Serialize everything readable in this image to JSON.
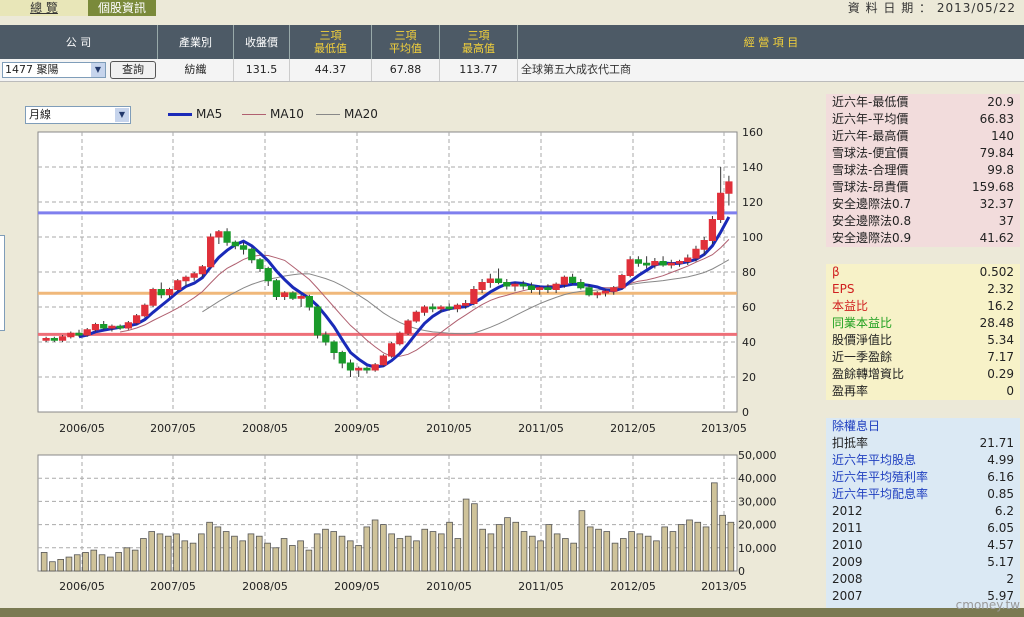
{
  "tabs": {
    "overview": "總 覽",
    "stock_info": "個股資訊"
  },
  "date_label": "資 料 日 期 ： 2013/05/22",
  "header": {
    "company": "公 司",
    "industry": "產業別",
    "close": "收盤價",
    "min": [
      "三項",
      "最低值"
    ],
    "avg": [
      "三項",
      "平均值"
    ],
    "max": [
      "三項",
      "最高值"
    ],
    "business": "經 營 項 目"
  },
  "row": {
    "stock_select": "1477 聚陽",
    "query_button": "查詢",
    "industry": "紡織",
    "close": "131.5",
    "min": "44.37",
    "avg": "67.88",
    "max": "113.77",
    "business": "全球第五大成衣代工商"
  },
  "period_select": "月線",
  "legend": [
    {
      "name": "MA5",
      "color": "#1a2ab8"
    },
    {
      "name": "MA10",
      "color": "#b06070"
    },
    {
      "name": "MA20",
      "color": "#888888"
    }
  ],
  "chart_data": [
    {
      "type": "candlestick",
      "x_labels": [
        "2006/05",
        "2007/05",
        "2008/05",
        "2009/05",
        "2010/05",
        "2011/05",
        "2012/05",
        "2013/05"
      ],
      "y_ticks": [
        0,
        20,
        40,
        60,
        80,
        100,
        120,
        140,
        160
      ],
      "ylim": [
        0,
        160
      ],
      "reference_lines": [
        {
          "name": "三項最高值",
          "value": 113.77,
          "color": "#7f7fee"
        },
        {
          "name": "三項平均值",
          "value": 67.88,
          "color": "#f0b87a"
        },
        {
          "name": "三項最低值",
          "value": 44.37,
          "color": "#ee6f78"
        }
      ],
      "ohlc": [
        [
          41,
          43,
          40,
          42
        ],
        [
          42,
          43,
          40,
          41
        ],
        [
          41,
          44,
          40,
          43
        ],
        [
          43,
          46,
          42,
          45
        ],
        [
          45,
          47,
          43,
          44
        ],
        [
          44,
          48,
          43,
          47
        ],
        [
          47,
          51,
          46,
          50
        ],
        [
          50,
          52,
          47,
          48
        ],
        [
          48,
          50,
          46,
          49
        ],
        [
          49,
          50,
          47,
          48
        ],
        [
          48,
          52,
          47,
          51
        ],
        [
          51,
          56,
          50,
          55
        ],
        [
          55,
          62,
          54,
          61
        ],
        [
          61,
          71,
          60,
          70
        ],
        [
          70,
          74,
          65,
          67
        ],
        [
          67,
          71,
          65,
          70
        ],
        [
          70,
          76,
          69,
          75
        ],
        [
          75,
          78,
          72,
          77
        ],
        [
          77,
          80,
          75,
          79
        ],
        [
          79,
          84,
          77,
          83
        ],
        [
          83,
          102,
          82,
          100
        ],
        [
          100,
          104,
          96,
          103
        ],
        [
          103,
          105,
          95,
          97
        ],
        [
          97,
          98,
          93,
          95
        ],
        [
          95,
          97,
          90,
          93
        ],
        [
          93,
          94,
          85,
          87
        ],
        [
          87,
          88,
          80,
          82
        ],
        [
          82,
          83,
          72,
          75
        ],
        [
          75,
          76,
          64,
          66
        ],
        [
          66,
          69,
          64,
          68
        ],
        [
          68,
          69,
          64,
          65
        ],
        [
          65,
          67,
          60,
          66
        ],
        [
          66,
          67,
          58,
          60
        ],
        [
          60,
          61,
          42,
          44
        ],
        [
          44,
          46,
          38,
          40
        ],
        [
          40,
          41,
          30,
          34
        ],
        [
          34,
          35,
          25,
          28
        ],
        [
          28,
          30,
          20,
          24
        ],
        [
          24,
          26,
          20,
          25
        ],
        [
          25,
          26,
          22,
          24
        ],
        [
          24,
          28,
          23,
          27
        ],
        [
          27,
          33,
          26,
          32
        ],
        [
          32,
          40,
          31,
          39
        ],
        [
          39,
          46,
          38,
          45
        ],
        [
          45,
          53,
          44,
          52
        ],
        [
          52,
          58,
          51,
          57
        ],
        [
          57,
          61,
          55,
          60
        ],
        [
          60,
          62,
          57,
          59
        ],
        [
          59,
          61,
          57,
          60
        ],
        [
          60,
          62,
          58,
          59
        ],
        [
          59,
          62,
          57,
          61
        ],
        [
          61,
          64,
          59,
          62
        ],
        [
          62,
          72,
          61,
          70
        ],
        [
          70,
          76,
          68,
          74
        ],
        [
          74,
          79,
          71,
          76
        ],
        [
          76,
          82,
          73,
          74
        ],
        [
          74,
          76,
          70,
          72
        ],
        [
          72,
          74,
          69,
          73
        ],
        [
          73,
          75,
          70,
          72
        ],
        [
          72,
          74,
          68,
          70
        ],
        [
          70,
          72,
          67,
          71
        ],
        [
          71,
          73,
          68,
          70
        ],
        [
          70,
          74,
          68,
          73
        ],
        [
          73,
          78,
          71,
          77
        ],
        [
          77,
          79,
          73,
          74
        ],
        [
          74,
          76,
          70,
          71
        ],
        [
          71,
          73,
          66,
          67
        ],
        [
          67,
          69,
          65,
          68
        ],
        [
          68,
          70,
          66,
          69
        ],
        [
          69,
          72,
          67,
          71
        ],
        [
          71,
          79,
          70,
          78
        ],
        [
          78,
          89,
          77,
          87
        ],
        [
          87,
          89,
          83,
          85
        ],
        [
          85,
          89,
          82,
          84
        ],
        [
          84,
          88,
          82,
          86
        ],
        [
          86,
          89,
          83,
          84
        ],
        [
          84,
          87,
          82,
          85
        ],
        [
          85,
          87,
          83,
          86
        ],
        [
          86,
          90,
          84,
          88
        ],
        [
          88,
          95,
          86,
          93
        ],
        [
          93,
          100,
          90,
          98
        ],
        [
          98,
          112,
          96,
          110
        ],
        [
          110,
          140,
          108,
          125
        ],
        [
          125,
          135,
          118,
          131.5
        ]
      ]
    },
    {
      "type": "bar",
      "x_labels": [
        "2006/05",
        "2007/05",
        "2008/05",
        "2009/05",
        "2010/05",
        "2011/05",
        "2012/05",
        "2013/05"
      ],
      "y_ticks": [
        0,
        10000,
        20000,
        30000,
        40000,
        50000
      ],
      "y_tick_labels": [
        "0",
        "10,000",
        "20,000",
        "30,000",
        "40,000",
        "50,000"
      ],
      "ylim": [
        0,
        50000
      ],
      "values": [
        8000,
        4000,
        5000,
        6000,
        7000,
        8000,
        9000,
        7000,
        6000,
        8000,
        10000,
        9000,
        14000,
        17000,
        16000,
        15000,
        16000,
        13000,
        12000,
        16000,
        21000,
        19000,
        17000,
        15000,
        13000,
        16000,
        15000,
        12000,
        10000,
        14000,
        11000,
        13000,
        9000,
        16000,
        18000,
        17000,
        15000,
        13000,
        11000,
        19000,
        22000,
        20000,
        16000,
        14000,
        15000,
        13000,
        18000,
        17000,
        16000,
        21000,
        14000,
        31000,
        29000,
        18000,
        16000,
        20000,
        23000,
        21000,
        17000,
        15000,
        13000,
        20000,
        16000,
        14000,
        12000,
        26000,
        19000,
        18000,
        17000,
        12000,
        14000,
        17000,
        16000,
        15000,
        13000,
        19000,
        17000,
        20000,
        22000,
        21000,
        19000,
        38000,
        24000,
        21000
      ]
    }
  ],
  "valuation": [
    {
      "label": "近六年-最低價",
      "value": "20.9"
    },
    {
      "label": "近六年-平均價",
      "value": "66.83"
    },
    {
      "label": "近六年-最高價",
      "value": "140"
    },
    {
      "label": "雪球法-便宜價",
      "value": "79.84"
    },
    {
      "label": "雪球法-合理價",
      "value": "99.8"
    },
    {
      "label": "雪球法-昂貴價",
      "value": "159.68"
    },
    {
      "label": "安全邊際法0.7",
      "value": "32.37"
    },
    {
      "label": "安全邊際法0.8",
      "value": "37"
    },
    {
      "label": "安全邊際法0.9",
      "value": "41.62"
    }
  ],
  "fundamentals": [
    {
      "label": "β",
      "value": "0.502",
      "color": "#d02020"
    },
    {
      "label": "EPS",
      "value": "2.32",
      "color": "#d02020"
    },
    {
      "label": "本益比",
      "value": "16.2",
      "color": "#d02020"
    },
    {
      "label": "同業本益比",
      "value": "28.48",
      "color": "#20a020"
    },
    {
      "label": "股價淨值比",
      "value": "5.34",
      "color": "#222222"
    },
    {
      "label": "近一季盈餘",
      "value": "7.17",
      "color": "#222222"
    },
    {
      "label": "盈餘轉增資比",
      "value": "0.29",
      "color": "#222222"
    },
    {
      "label": "盈再率",
      "value": "0",
      "color": "#222222"
    }
  ],
  "dividends": [
    {
      "label": "除權息日",
      "value": "",
      "color": "#2040c0"
    },
    {
      "label": "扣抵率",
      "value": "21.71",
      "color": "#222222"
    },
    {
      "label": "近六年平均股息",
      "value": "4.99",
      "color": "#2040c0"
    },
    {
      "label": "近六年平均殖利率",
      "value": "6.16",
      "color": "#2040c0"
    },
    {
      "label": "近六年平均配息率",
      "value": "0.85",
      "color": "#2040c0"
    },
    {
      "label": "2012",
      "value": "6.2",
      "color": "#222222"
    },
    {
      "label": "2011",
      "value": "6.05",
      "color": "#222222"
    },
    {
      "label": "2010",
      "value": "4.57",
      "color": "#222222"
    },
    {
      "label": "2009",
      "value": "5.17",
      "color": "#222222"
    },
    {
      "label": "2008",
      "value": "2",
      "color": "#222222"
    },
    {
      "label": "2007",
      "value": "5.97",
      "color": "#222222"
    }
  ],
  "watermark": "cmoney.tw"
}
